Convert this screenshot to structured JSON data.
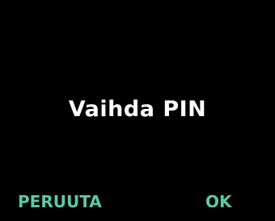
{
  "dialog": {
    "title": "Vaihda PIN"
  },
  "softkeys": {
    "cancel_label": "PERUUTA",
    "ok_label": "OK"
  },
  "colors": {
    "background": "#000000",
    "title_text": "#ffffff",
    "softkey_text": "#5cc8a8"
  }
}
